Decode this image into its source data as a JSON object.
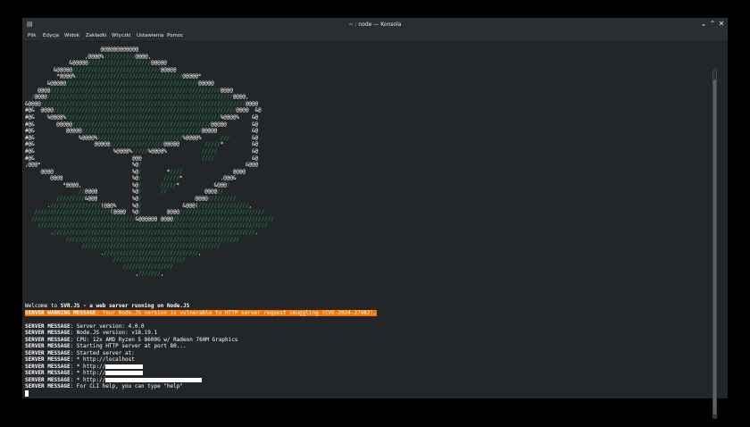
{
  "window": {
    "title": "~ : node — Konsola",
    "controls": [
      "⌄",
      "⌃",
      "✕"
    ]
  },
  "menu": [
    "Plik",
    "Edycja",
    "Widok",
    "Zakładki",
    "Wtyczki",
    "Ustawienia",
    "Pomoc"
  ],
  "terminal": {
    "ascii_art_lines": [
      "                        @@@@@@@@@@@@",
      "                   ,@@@@%//////////@@@@,",
      "              &@@@@@////////////////////@@@@@",
      "         &@@@@@////////////////////////////@@@@@",
      "          *@@@@%//////////////////////////////////@@@@@*",
      "       &@@@@@//////////////////////////////////////////@@@@@",
      "    @@@@//////////////////////////////////////////////////////@@@@",
      "  /@@@@///////////////////////////////////////////////////////////@@@@,",
      "&@@@@/////////////////////////////////////////////////////////////////@@@@",
      "#@&  @@@@//////////////////////////////////////////////////////////@@@@  &@",
      "#@&    %@@@@%/////////////////////////////////////////////////%@@@@%    &@",
      "#@&       @@@@@////////////////////////////////////////////@@@@@        &@",
      "#@&          @@@@@//////////////////////////////////////@@@@@           &@",
      "#@&              %@@@@%///////////////////////////%@@@@%      ///       &@",
      "#@&                   @@@@@/////////////////@@@@@        /////*         &@",
      "#@&                         %@@@@%/////%@@@@%           /////           &@",
      "#@&                               @@@                   ////            &@",
      ",@@@*                             %@/                                 &@@@",
      "     @@@@                         %@/        *////                @@@@",
      "        @@@@                      %@/       /////*            .@@@&",
      "            *@@@@,                %@/      /////*           &@@@/",
      "                 //@@@@           %@/      //            @@@@//",
      "          /////////&@@@           %@/                 @@@@/////////",
      "       .////////////////(@@@%     %@/             &@@@(////////////////,",
      "   ////////////////////////(@@@@  %@/        @@@@///////////////////////////",
      "  /////////////////////////////////&@@@@@@ @@@@////////////////////////////////",
      "    /////////////////////////////////////////////////////////////////////////",
      "        .////////////////////////////////////////////////////////////////.",
      "             ///////////////////////////////////////////////////////",
      "                  ////////////////////////////////////////////",
      "                        .//////////////////////////////,",
      "                            ///////////////////////",
      "                               ////////////////",
      "                                   ,///////,"
    ],
    "welcome_prefix": "Welcome to ",
    "welcome_name": "SVR.JS",
    "welcome_suffix": " - a web server running on Node.JS",
    "warning_label": "SERVER WARNING MESSAGE",
    "warning_text": ": Your Node.JS version is vulnerable to HTTP server request smuggling (CVE-2024-27982).",
    "message_label": "SERVER MESSAGE",
    "messages": [
      ": Server version: 4.0.0",
      ": Node.JS version: v18.19.1",
      ": CPU: 12x AMD Ryzen 5 8600G w/ Radeon 760M Graphics",
      ": Starting HTTP server at port 80...",
      ": Started server at:",
      ": * http://localhost",
      ": * http://",
      ": * http://",
      ": * http://",
      ": For CLI help, you can type \"help\""
    ]
  },
  "colors": {
    "background": "#232629",
    "foreground": "#fcfcfc",
    "ascii_accent": "#1b9d52",
    "warning_bg": "#f67400"
  }
}
